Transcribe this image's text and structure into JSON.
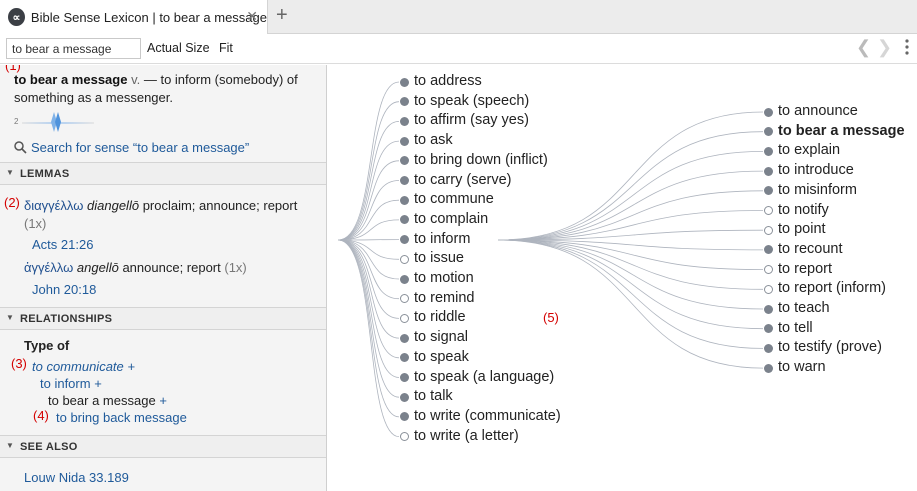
{
  "tab": {
    "logo": "∝",
    "title": "Bible Sense Lexicon | to bear a message",
    "close": "✕",
    "add": "+"
  },
  "toolbar": {
    "search_value": "to bear a message",
    "actual_size": "Actual Size",
    "fit": "Fit",
    "back": "❮",
    "forward": "❯"
  },
  "annotations": {
    "a1": "(1)",
    "a2": "(2)",
    "a3": "(3)",
    "a4": "(4)",
    "a5": "(5)"
  },
  "definition": {
    "headword": "to bear a message",
    "pos": "v.",
    "text": " — to inform (somebody) of something as a messenger."
  },
  "slider": {
    "min_label": "2"
  },
  "search_sense": "Search for sense “to bear a message”",
  "sections": {
    "lemmas": "LEMMAS",
    "relationships": "RELATIONSHIPS",
    "see_also": "SEE ALSO"
  },
  "lemmas": [
    {
      "greek": "διαγγέλλω",
      "translit": "diangellō",
      "gloss": "proclaim; announce; report",
      "count": "(1x)",
      "ref": "Acts 21:26"
    },
    {
      "greek": "ἀγγέλλω",
      "translit": "angellō",
      "gloss": "announce; report",
      "count": "(1x)",
      "ref": "John 20:18"
    }
  ],
  "relationships": {
    "type_label": "Type of",
    "level1": "to communicate",
    "level2": "to inform",
    "level3": "to bear a message",
    "child": "to bring back message",
    "plus": "+"
  },
  "see_also": "Louw Nida 33.189",
  "graph": {
    "center": "to bear a message",
    "left_nodes": [
      {
        "label": "to address",
        "filled": true
      },
      {
        "label": "to speak (speech)",
        "filled": true
      },
      {
        "label": "to affirm (say yes)",
        "filled": true
      },
      {
        "label": "to ask",
        "filled": true
      },
      {
        "label": "to bring down (inflict)",
        "filled": true
      },
      {
        "label": "to carry (serve)",
        "filled": true
      },
      {
        "label": "to commune",
        "filled": true
      },
      {
        "label": "to complain",
        "filled": true
      },
      {
        "label": "to inform",
        "filled": true
      },
      {
        "label": "to issue",
        "filled": false
      },
      {
        "label": "to motion",
        "filled": true
      },
      {
        "label": "to remind",
        "filled": false
      },
      {
        "label": "to riddle",
        "filled": false
      },
      {
        "label": "to signal",
        "filled": true
      },
      {
        "label": "to speak",
        "filled": true
      },
      {
        "label": "to speak (a language)",
        "filled": true
      },
      {
        "label": "to talk",
        "filled": true
      },
      {
        "label": "to write (communicate)",
        "filled": true
      },
      {
        "label": "to write (a letter)",
        "filled": false
      }
    ],
    "right_nodes": [
      {
        "label": "to announce",
        "filled": true
      },
      {
        "label": "to bear a message",
        "filled": true
      },
      {
        "label": "to explain",
        "filled": true
      },
      {
        "label": "to introduce",
        "filled": true
      },
      {
        "label": "to misinform",
        "filled": true
      },
      {
        "label": "to notify",
        "filled": false
      },
      {
        "label": "to point",
        "filled": false
      },
      {
        "label": "to recount",
        "filled": true
      },
      {
        "label": "to report",
        "filled": false
      },
      {
        "label": "to report (inform)",
        "filled": false
      },
      {
        "label": "to teach",
        "filled": true
      },
      {
        "label": "to tell",
        "filled": true
      },
      {
        "label": "to testify (prove)",
        "filled": true
      },
      {
        "label": "to warn",
        "filled": true
      }
    ]
  }
}
